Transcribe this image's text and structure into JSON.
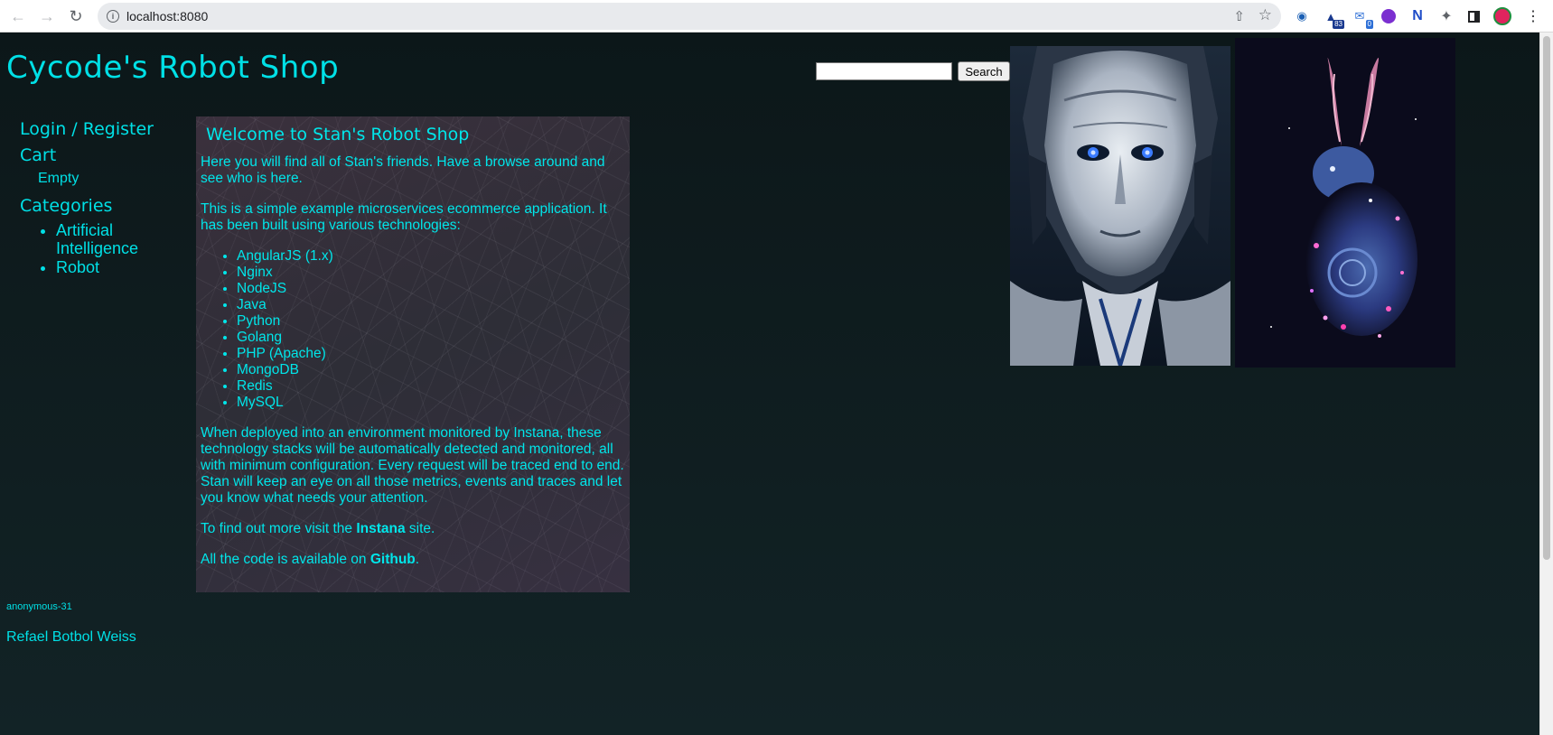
{
  "browser": {
    "url": "localhost:8080",
    "extension_badges": [
      "83",
      "0"
    ]
  },
  "header": {
    "title": "Cycode's Robot Shop",
    "search_placeholder": "",
    "search_button": "Search"
  },
  "sidebar": {
    "login_register": "Login / Register",
    "cart": "Cart",
    "cart_status": "Empty",
    "categories_heading": "Categories",
    "categories": [
      "Artificial Intelligence",
      "Robot"
    ]
  },
  "welcome": {
    "heading": "Welcome to Stan's Robot Shop",
    "intro": "Here you will find all of Stan's friends. Have a browse around and see who is here.",
    "tech_intro": "This is a simple example microservices ecommerce application. It has been built using various technologies:",
    "technologies": [
      "AngularJS (1.x)",
      "Nginx",
      "NodeJS",
      "Java",
      "Python",
      "Golang",
      "PHP (Apache)",
      "MongoDB",
      "Redis",
      "MySQL"
    ],
    "monitoring": "When deployed into an environment monitored by Instana, these technology stacks will be automatically detected and monitored, all with minimum configuration. Every request will be traced end to end. Stan will keep an eye on all those metrics, events and traces and let you know what needs your attention.",
    "find_out_prefix": "To find out more visit the ",
    "find_out_link": "Instana",
    "find_out_suffix": " site.",
    "code_prefix": "All the code is available on ",
    "code_link": "Github",
    "code_suffix": "."
  },
  "footer": {
    "user_id": "anonymous-31",
    "author": "Refael Botbol Weiss"
  },
  "colors": {
    "accent": "#00e0e6",
    "background": "#0f1c1f"
  }
}
